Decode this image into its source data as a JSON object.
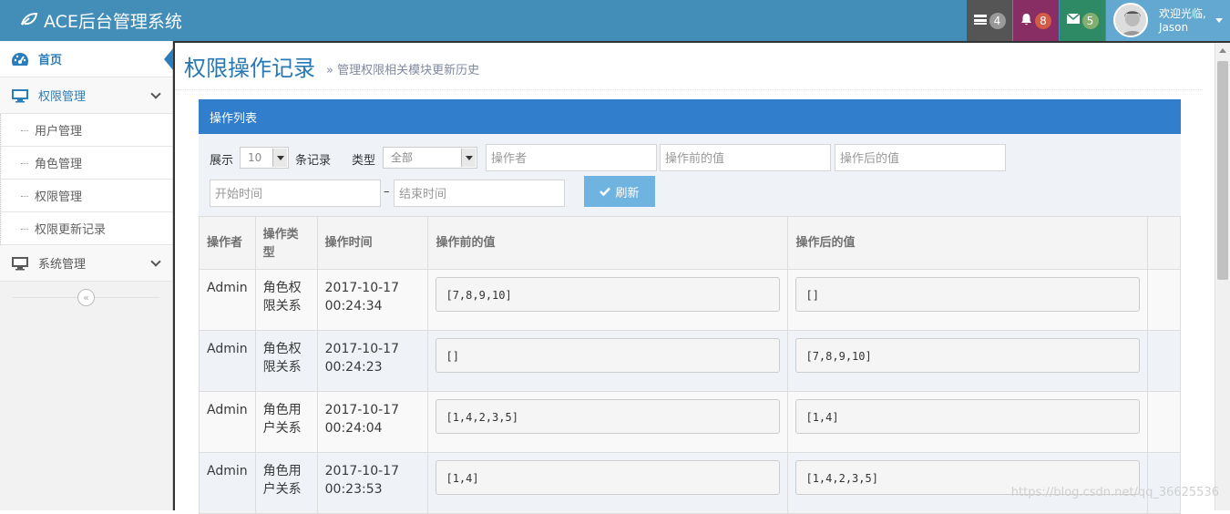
{
  "app": {
    "title": "ACE后台管理系统"
  },
  "navbar": {
    "tasks_count": "4",
    "notifications_count": "8",
    "messages_count": "5",
    "user_greeting": "欢迎光临,",
    "user_name": "Jason"
  },
  "sidebar": {
    "items": [
      {
        "label": "首页",
        "icon": "dashboard-icon"
      },
      {
        "label": "权限管理",
        "icon": "desktop-icon"
      },
      {
        "label": "系统管理",
        "icon": "desktop-icon"
      }
    ],
    "subitems": [
      "用户管理",
      "角色管理",
      "权限管理",
      "权限更新记录"
    ]
  },
  "page": {
    "title": "权限操作记录",
    "subtitle": "» 管理权限相关模块更新历史"
  },
  "widget": {
    "title": "操作列表"
  },
  "filters": {
    "show_label": "展示",
    "show_value": "10",
    "records_label": "条记录",
    "type_label": "类型",
    "type_value": "全部",
    "operator_placeholder": "操作者",
    "before_placeholder": "操作前的值",
    "after_placeholder": "操作后的值",
    "start_placeholder": "开始时间",
    "range_sep": "–",
    "end_placeholder": "结束时间",
    "refresh_label": "刷新"
  },
  "table": {
    "headers": [
      "操作者",
      "操作类型",
      "操作时间",
      "操作前的值",
      "操作后的值"
    ],
    "rows": [
      {
        "operator": "Admin",
        "type": "角色权限关系",
        "time": "2017-10-17 00:24:34",
        "before": "[7,8,9,10]",
        "after": "[]"
      },
      {
        "operator": "Admin",
        "type": "角色权限关系",
        "time": "2017-10-17 00:24:23",
        "before": "[]",
        "after": "[7,8,9,10]"
      },
      {
        "operator": "Admin",
        "type": "角色用户关系",
        "time": "2017-10-17 00:24:04",
        "before": "[1,4,2,3,5]",
        "after": "[1,4]"
      },
      {
        "operator": "Admin",
        "type": "角色用户关系",
        "time": "2017-10-17 00:23:53",
        "before": "[1,4]",
        "after": "[1,4,2,3,5]"
      }
    ]
  },
  "watermark": "https://blog.csdn.net/qq_36625536"
}
